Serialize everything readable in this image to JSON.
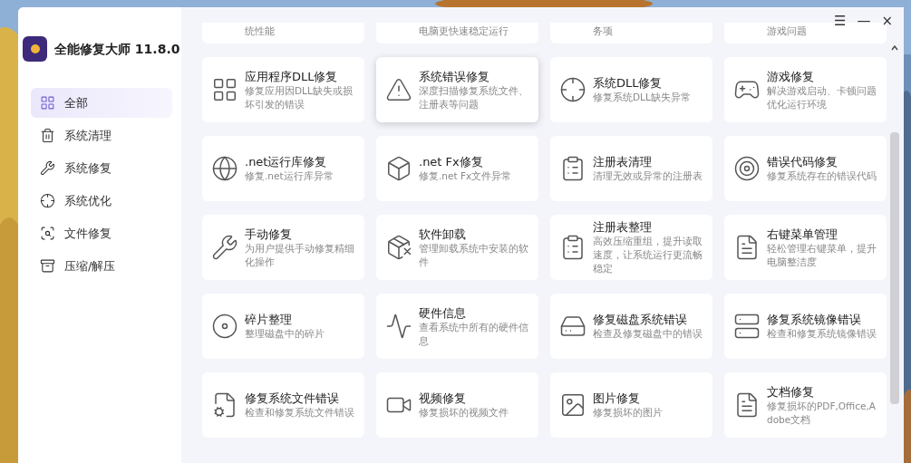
{
  "app": {
    "title": "全能修复大师 11.8.0"
  },
  "window_controls": [
    "☰",
    "—",
    "×"
  ],
  "sidebar": {
    "items": [
      {
        "label": "全部",
        "selected": true
      },
      {
        "label": "系统清理",
        "selected": false
      },
      {
        "label": "系统修复",
        "selected": false
      },
      {
        "label": "系统优化",
        "selected": false
      },
      {
        "label": "文件修复",
        "selected": false
      },
      {
        "label": "压缩/解压",
        "selected": false
      }
    ]
  },
  "partial_row": [
    "统性能",
    "电脑更快速稳定运行",
    "务项",
    "游戏问题"
  ],
  "tools": [
    {
      "title": "应用程序DLL修复",
      "description": "修复应用因DLL缺失或损坏引发的错误",
      "hovered": false
    },
    {
      "title": "系统错误修复",
      "description": "深度扫描修复系统文件、注册表等问题",
      "hovered": true
    },
    {
      "title": "系统DLL修复",
      "description": "修复系统DLL缺失异常",
      "hovered": false
    },
    {
      "title": "游戏修复",
      "description": "解决游戏启动、卡顿问题优化运行环境",
      "hovered": false
    },
    {
      "title": ".net运行库修复",
      "description": "修复.net运行库异常",
      "hovered": false
    },
    {
      "title": ".net Fx修复",
      "description": "修复.net Fx文件异常",
      "hovered": false
    },
    {
      "title": "注册表清理",
      "description": "清理无效或异常的注册表",
      "hovered": false
    },
    {
      "title": "错误代码修复",
      "description": "修复系统存在的错误代码",
      "hovered": false
    },
    {
      "title": "手动修复",
      "description": "为用户提供手动修复精细化操作",
      "hovered": false
    },
    {
      "title": "软件卸载",
      "description": "管理卸载系统中安装的软件",
      "hovered": false
    },
    {
      "title": "注册表整理",
      "description": "高效压缩重组，提升读取速度，让系统运行更流畅稳定",
      "hovered": false
    },
    {
      "title": "右键菜单管理",
      "description": "轻松管理右键菜单，提升电脑整洁度",
      "hovered": false
    },
    {
      "title": "碎片整理",
      "description": "整理磁盘中的碎片",
      "hovered": false
    },
    {
      "title": "硬件信息",
      "description": "查看系统中所有的硬件信息",
      "hovered": false
    },
    {
      "title": "修复磁盘系统错误",
      "description": "检查及修复磁盘中的错误",
      "hovered": false
    },
    {
      "title": "修复系统镜像错误",
      "description": "检查和修复系统镜像错误",
      "hovered": false
    },
    {
      "title": "修复系统文件错误",
      "description": "检查和修复系统文件错误",
      "hovered": false
    },
    {
      "title": "视频修复",
      "description": "修复损坏的视频文件",
      "hovered": false
    },
    {
      "title": "图片修复",
      "description": "修复损坏的图片",
      "hovered": false
    },
    {
      "title": "文档修复",
      "description": "修复损坏的PDF,Office,Adobe文档",
      "hovered": false
    }
  ]
}
